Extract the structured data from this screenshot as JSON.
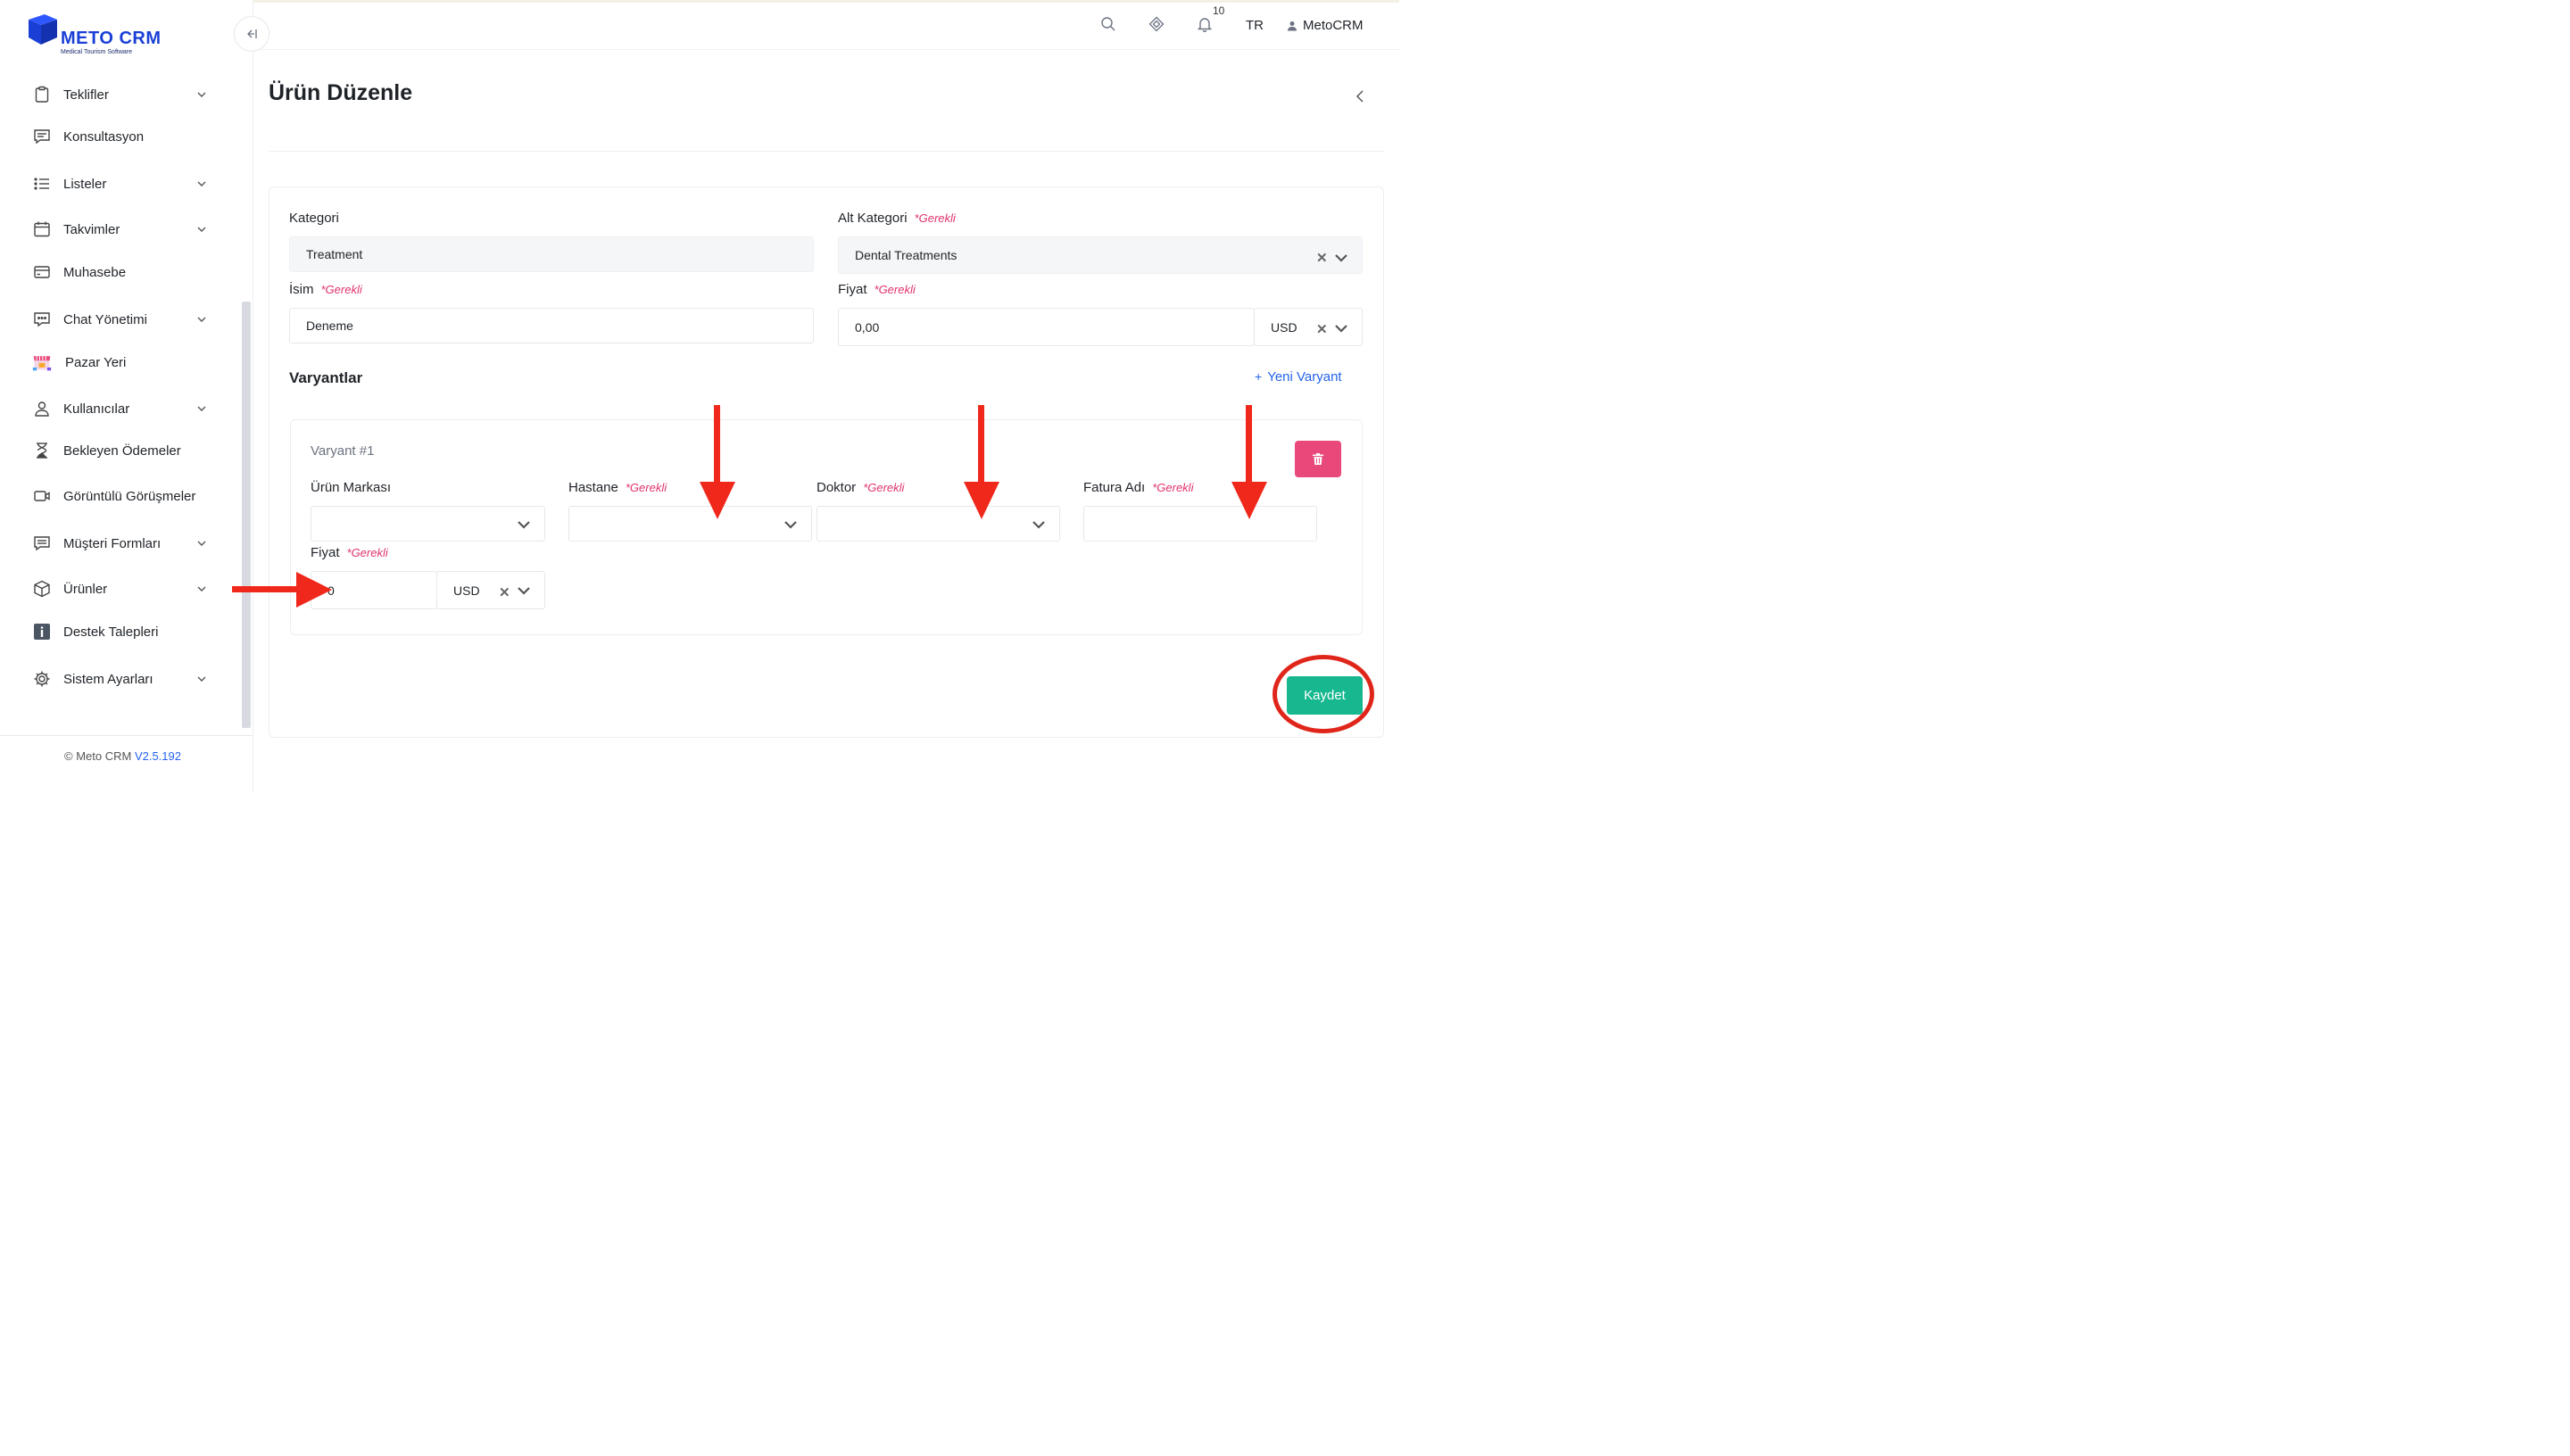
{
  "brand": {
    "name": "METO CRM",
    "tagline": "Medical Tourism Software"
  },
  "sidebar": {
    "items": [
      {
        "label": "Teklifler",
        "icon": "clipboard-icon",
        "has_submenu": true
      },
      {
        "label": "Konsultasyon",
        "icon": "message-square-icon",
        "has_submenu": false
      },
      {
        "label": "Listeler",
        "icon": "list-icon",
        "has_submenu": true
      },
      {
        "label": "Takvimler",
        "icon": "calendar-icon",
        "has_submenu": true
      },
      {
        "label": "Muhasebe",
        "icon": "credit-card-icon",
        "has_submenu": false
      },
      {
        "label": "Chat Yönetimi",
        "icon": "chat-bubble-icon",
        "has_submenu": true
      },
      {
        "label": "Pazar Yeri",
        "icon": "storefront-icon",
        "has_submenu": false
      },
      {
        "label": "Kullanıcılar",
        "icon": "user-icon",
        "has_submenu": true
      },
      {
        "label": "Bekleyen Ödemeler",
        "icon": "hourglass-icon",
        "has_submenu": false
      },
      {
        "label": "Görüntülü Görüşmeler",
        "icon": "video-camera-icon",
        "has_submenu": false
      },
      {
        "label": "Müşteri Formları",
        "icon": "form-icon",
        "has_submenu": true
      },
      {
        "label": "Ürünler",
        "icon": "box-icon",
        "has_submenu": true
      },
      {
        "label": "Destek Talepleri",
        "icon": "info-icon",
        "has_submenu": false
      },
      {
        "label": "Sistem Ayarları",
        "icon": "gear-icon",
        "has_submenu": true
      }
    ],
    "footer": {
      "copyright": "© Meto CRM",
      "version": "V2.5.192"
    }
  },
  "header": {
    "notification_count": "10",
    "language": "TR",
    "user_name": "MetoCRM"
  },
  "page": {
    "title": "Ürün Düzenle",
    "required_text": "*Gerekli",
    "form": {
      "category": {
        "label": "Kategori",
        "value": "Treatment"
      },
      "sub_category": {
        "label": "Alt Kategori",
        "value": "Dental Treatments"
      },
      "name": {
        "label": "İsim",
        "value": "Deneme"
      },
      "price": {
        "label": "Fiyat",
        "value": "0,00",
        "currency": "USD"
      }
    },
    "variants_title": "Varyantlar",
    "new_variant_label": "Yeni Varyant",
    "variant": {
      "title": "Varyant #1",
      "brand_label": "Ürün Markası",
      "hospital_label": "Hastane",
      "doctor_label": "Doktor",
      "invoice_name_label": "Fatura Adı",
      "price_label": "Fiyat",
      "price_value": "0",
      "currency": "USD"
    },
    "save_label": "Kaydet"
  },
  "colors": {
    "accent": "#2563eb",
    "save": "#17b890",
    "delete": "#e9487a",
    "required": "#e0336e",
    "annotation": "#e0261b"
  }
}
